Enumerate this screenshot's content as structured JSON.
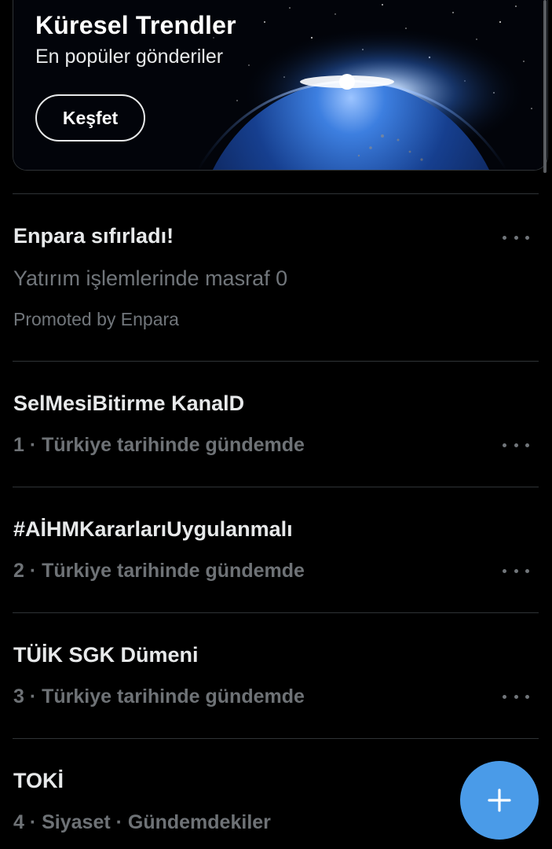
{
  "banner": {
    "title": "Küresel Trendler",
    "subtitle": "En popüler gönderiler",
    "button_label": "Keşfet"
  },
  "promoted": {
    "title": "Enpara sıfırladı!",
    "description": "Yatırım işlemlerinde masraf 0",
    "promoted_by": "Promoted by Enpara"
  },
  "trends": [
    {
      "title": "SelMesiBitirme KanalD",
      "meta": "1 · Türkiye tarihinde gündemde"
    },
    {
      "title": "#AİHMKararlarıUygulanmalı",
      "meta": "2 · Türkiye tarihinde gündemde"
    },
    {
      "title": "TÜİK SGK Dümeni",
      "meta": "3 · Türkiye tarihinde gündemde"
    },
    {
      "title": "TOKİ",
      "meta": "4 · Siyaset · Gündemdekiler"
    }
  ],
  "icons": {
    "more": "more-horizontal-icon",
    "compose": "plus-icon"
  },
  "colors": {
    "background": "#000000",
    "primary_text": "#e7e9ea",
    "secondary_text": "#71767b",
    "divider": "#2f3336",
    "fab": "#4a9be8"
  }
}
